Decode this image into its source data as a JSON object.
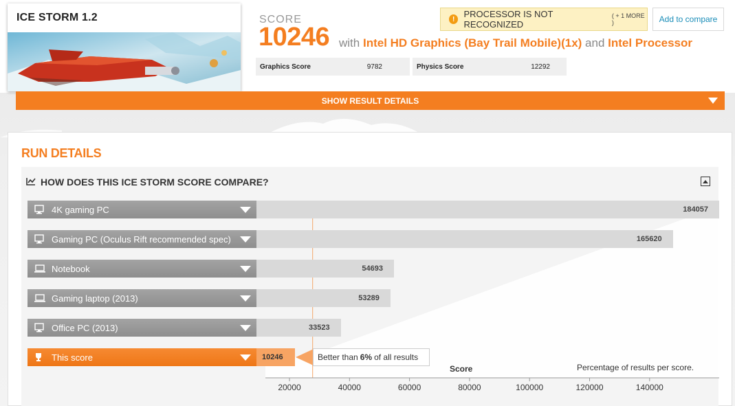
{
  "game": {
    "title": "ICE STORM 1.2"
  },
  "score": {
    "label": "SCORE",
    "value": "10246",
    "with_text": "with",
    "gpu": "Intel HD Graphics (Bay Trail Mobile)(1x)",
    "and_text": "and",
    "cpu": "Intel Processor"
  },
  "subscores": [
    {
      "label": "Graphics Score",
      "value": "9782"
    },
    {
      "label": "Physics Score",
      "value": "12292"
    }
  ],
  "warning": {
    "text": "PROCESSOR IS NOT RECOGNIZED",
    "more": "( + 1 MORE )",
    "icon": "exclamation-icon"
  },
  "compare_button": "Add to compare",
  "show_details": "SHOW RESULT DETAILS",
  "run_details": {
    "title": "RUN DETAILS",
    "compare_title": "HOW DOES THIS ICE STORM SCORE COMPARE?"
  },
  "colors": {
    "accent": "#f47e20",
    "bar": "#d9d9d9",
    "label_bg": "#969696",
    "link": "#1a8db8"
  },
  "chart_data": {
    "type": "bar",
    "orientation": "horizontal",
    "categories": [
      "4K gaming PC",
      "Gaming PC (Oculus Rift recommended spec)",
      "Notebook",
      "Gaming laptop (2013)",
      "Office PC (2013)",
      "This score"
    ],
    "values": [
      184057,
      165620,
      54693,
      53289,
      33523,
      10246
    ],
    "value_labels": [
      "184057",
      "165620",
      "54693",
      "53289",
      "33523",
      "10246"
    ],
    "icons": [
      "desktop-icon",
      "desktop-icon",
      "laptop-icon",
      "laptop-icon",
      "desktop-icon",
      "trophy-icon"
    ],
    "xlabel": "Score",
    "distribution_label": "Percentage of results per score.",
    "xticks": [
      20000,
      40000,
      60000,
      80000,
      100000,
      120000,
      140000
    ],
    "xtick_labels": [
      "20000",
      "40000",
      "60000",
      "80000",
      "100000",
      "120000",
      "140000"
    ],
    "marker_value": 10246,
    "reference_line": 20000,
    "tooltip": {
      "prefix": "Better than ",
      "percent": "6%",
      "suffix": " of all results"
    }
  }
}
